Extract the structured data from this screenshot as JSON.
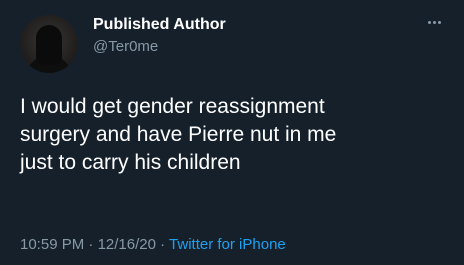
{
  "tweet": {
    "author": {
      "name": "Published Author",
      "handle": "@Ter0me",
      "avatar_icon": "hooded-figure-avatar"
    },
    "more_icon": "more-horizontal-icon",
    "text_lines": [
      "I would get gender reassignment",
      "surgery and have Pierre nut in me",
      "just to carry his children"
    ],
    "time": "10:59 PM",
    "separator": "·",
    "date": "12/16/20",
    "source": "Twitter for iPhone"
  },
  "colors": {
    "background": "#15202b",
    "text": "#ffffff",
    "secondary": "#8899a6",
    "link": "#1da1f2"
  }
}
